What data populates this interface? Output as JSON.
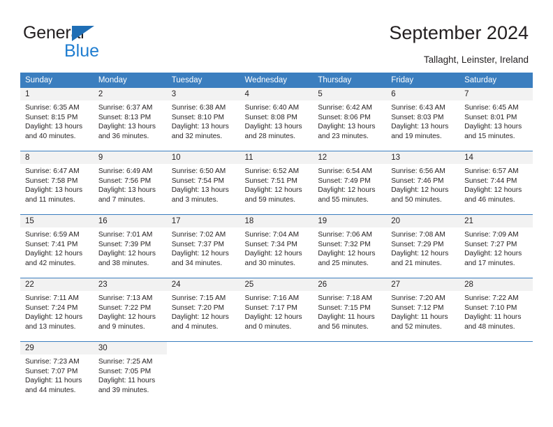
{
  "brand": {
    "name_part1": "General",
    "name_part2": "Blue",
    "triangle_icon": "blue-triangle-icon",
    "color_dark": "#231f20",
    "color_blue": "#1f7dd0"
  },
  "header": {
    "title": "September 2024",
    "subtitle": "Tallaght, Leinster, Ireland"
  },
  "calendar": {
    "header_bg": "#3b7ebf",
    "daynum_bg": "#f2f2f2",
    "weekdays": [
      "Sunday",
      "Monday",
      "Tuesday",
      "Wednesday",
      "Thursday",
      "Friday",
      "Saturday"
    ],
    "weeks": [
      [
        {
          "day": "1",
          "sunrise": "Sunrise: 6:35 AM",
          "sunset": "Sunset: 8:15 PM",
          "daylight_line1": "Daylight: 13 hours",
          "daylight_line2": "and 40 minutes."
        },
        {
          "day": "2",
          "sunrise": "Sunrise: 6:37 AM",
          "sunset": "Sunset: 8:13 PM",
          "daylight_line1": "Daylight: 13 hours",
          "daylight_line2": "and 36 minutes."
        },
        {
          "day": "3",
          "sunrise": "Sunrise: 6:38 AM",
          "sunset": "Sunset: 8:10 PM",
          "daylight_line1": "Daylight: 13 hours",
          "daylight_line2": "and 32 minutes."
        },
        {
          "day": "4",
          "sunrise": "Sunrise: 6:40 AM",
          "sunset": "Sunset: 8:08 PM",
          "daylight_line1": "Daylight: 13 hours",
          "daylight_line2": "and 28 minutes."
        },
        {
          "day": "5",
          "sunrise": "Sunrise: 6:42 AM",
          "sunset": "Sunset: 8:06 PM",
          "daylight_line1": "Daylight: 13 hours",
          "daylight_line2": "and 23 minutes."
        },
        {
          "day": "6",
          "sunrise": "Sunrise: 6:43 AM",
          "sunset": "Sunset: 8:03 PM",
          "daylight_line1": "Daylight: 13 hours",
          "daylight_line2": "and 19 minutes."
        },
        {
          "day": "7",
          "sunrise": "Sunrise: 6:45 AM",
          "sunset": "Sunset: 8:01 PM",
          "daylight_line1": "Daylight: 13 hours",
          "daylight_line2": "and 15 minutes."
        }
      ],
      [
        {
          "day": "8",
          "sunrise": "Sunrise: 6:47 AM",
          "sunset": "Sunset: 7:58 PM",
          "daylight_line1": "Daylight: 13 hours",
          "daylight_line2": "and 11 minutes."
        },
        {
          "day": "9",
          "sunrise": "Sunrise: 6:49 AM",
          "sunset": "Sunset: 7:56 PM",
          "daylight_line1": "Daylight: 13 hours",
          "daylight_line2": "and 7 minutes."
        },
        {
          "day": "10",
          "sunrise": "Sunrise: 6:50 AM",
          "sunset": "Sunset: 7:54 PM",
          "daylight_line1": "Daylight: 13 hours",
          "daylight_line2": "and 3 minutes."
        },
        {
          "day": "11",
          "sunrise": "Sunrise: 6:52 AM",
          "sunset": "Sunset: 7:51 PM",
          "daylight_line1": "Daylight: 12 hours",
          "daylight_line2": "and 59 minutes."
        },
        {
          "day": "12",
          "sunrise": "Sunrise: 6:54 AM",
          "sunset": "Sunset: 7:49 PM",
          "daylight_line1": "Daylight: 12 hours",
          "daylight_line2": "and 55 minutes."
        },
        {
          "day": "13",
          "sunrise": "Sunrise: 6:56 AM",
          "sunset": "Sunset: 7:46 PM",
          "daylight_line1": "Daylight: 12 hours",
          "daylight_line2": "and 50 minutes."
        },
        {
          "day": "14",
          "sunrise": "Sunrise: 6:57 AM",
          "sunset": "Sunset: 7:44 PM",
          "daylight_line1": "Daylight: 12 hours",
          "daylight_line2": "and 46 minutes."
        }
      ],
      [
        {
          "day": "15",
          "sunrise": "Sunrise: 6:59 AM",
          "sunset": "Sunset: 7:41 PM",
          "daylight_line1": "Daylight: 12 hours",
          "daylight_line2": "and 42 minutes."
        },
        {
          "day": "16",
          "sunrise": "Sunrise: 7:01 AM",
          "sunset": "Sunset: 7:39 PM",
          "daylight_line1": "Daylight: 12 hours",
          "daylight_line2": "and 38 minutes."
        },
        {
          "day": "17",
          "sunrise": "Sunrise: 7:02 AM",
          "sunset": "Sunset: 7:37 PM",
          "daylight_line1": "Daylight: 12 hours",
          "daylight_line2": "and 34 minutes."
        },
        {
          "day": "18",
          "sunrise": "Sunrise: 7:04 AM",
          "sunset": "Sunset: 7:34 PM",
          "daylight_line1": "Daylight: 12 hours",
          "daylight_line2": "and 30 minutes."
        },
        {
          "day": "19",
          "sunrise": "Sunrise: 7:06 AM",
          "sunset": "Sunset: 7:32 PM",
          "daylight_line1": "Daylight: 12 hours",
          "daylight_line2": "and 25 minutes."
        },
        {
          "day": "20",
          "sunrise": "Sunrise: 7:08 AM",
          "sunset": "Sunset: 7:29 PM",
          "daylight_line1": "Daylight: 12 hours",
          "daylight_line2": "and 21 minutes."
        },
        {
          "day": "21",
          "sunrise": "Sunrise: 7:09 AM",
          "sunset": "Sunset: 7:27 PM",
          "daylight_line1": "Daylight: 12 hours",
          "daylight_line2": "and 17 minutes."
        }
      ],
      [
        {
          "day": "22",
          "sunrise": "Sunrise: 7:11 AM",
          "sunset": "Sunset: 7:24 PM",
          "daylight_line1": "Daylight: 12 hours",
          "daylight_line2": "and 13 minutes."
        },
        {
          "day": "23",
          "sunrise": "Sunrise: 7:13 AM",
          "sunset": "Sunset: 7:22 PM",
          "daylight_line1": "Daylight: 12 hours",
          "daylight_line2": "and 9 minutes."
        },
        {
          "day": "24",
          "sunrise": "Sunrise: 7:15 AM",
          "sunset": "Sunset: 7:20 PM",
          "daylight_line1": "Daylight: 12 hours",
          "daylight_line2": "and 4 minutes."
        },
        {
          "day": "25",
          "sunrise": "Sunrise: 7:16 AM",
          "sunset": "Sunset: 7:17 PM",
          "daylight_line1": "Daylight: 12 hours",
          "daylight_line2": "and 0 minutes."
        },
        {
          "day": "26",
          "sunrise": "Sunrise: 7:18 AM",
          "sunset": "Sunset: 7:15 PM",
          "daylight_line1": "Daylight: 11 hours",
          "daylight_line2": "and 56 minutes."
        },
        {
          "day": "27",
          "sunrise": "Sunrise: 7:20 AM",
          "sunset": "Sunset: 7:12 PM",
          "daylight_line1": "Daylight: 11 hours",
          "daylight_line2": "and 52 minutes."
        },
        {
          "day": "28",
          "sunrise": "Sunrise: 7:22 AM",
          "sunset": "Sunset: 7:10 PM",
          "daylight_line1": "Daylight: 11 hours",
          "daylight_line2": "and 48 minutes."
        }
      ],
      [
        {
          "day": "29",
          "sunrise": "Sunrise: 7:23 AM",
          "sunset": "Sunset: 7:07 PM",
          "daylight_line1": "Daylight: 11 hours",
          "daylight_line2": "and 44 minutes."
        },
        {
          "day": "30",
          "sunrise": "Sunrise: 7:25 AM",
          "sunset": "Sunset: 7:05 PM",
          "daylight_line1": "Daylight: 11 hours",
          "daylight_line2": "and 39 minutes."
        },
        {
          "day": "",
          "sunrise": "",
          "sunset": "",
          "daylight_line1": "",
          "daylight_line2": ""
        },
        {
          "day": "",
          "sunrise": "",
          "sunset": "",
          "daylight_line1": "",
          "daylight_line2": ""
        },
        {
          "day": "",
          "sunrise": "",
          "sunset": "",
          "daylight_line1": "",
          "daylight_line2": ""
        },
        {
          "day": "",
          "sunrise": "",
          "sunset": "",
          "daylight_line1": "",
          "daylight_line2": ""
        },
        {
          "day": "",
          "sunrise": "",
          "sunset": "",
          "daylight_line1": "",
          "daylight_line2": ""
        }
      ]
    ]
  }
}
